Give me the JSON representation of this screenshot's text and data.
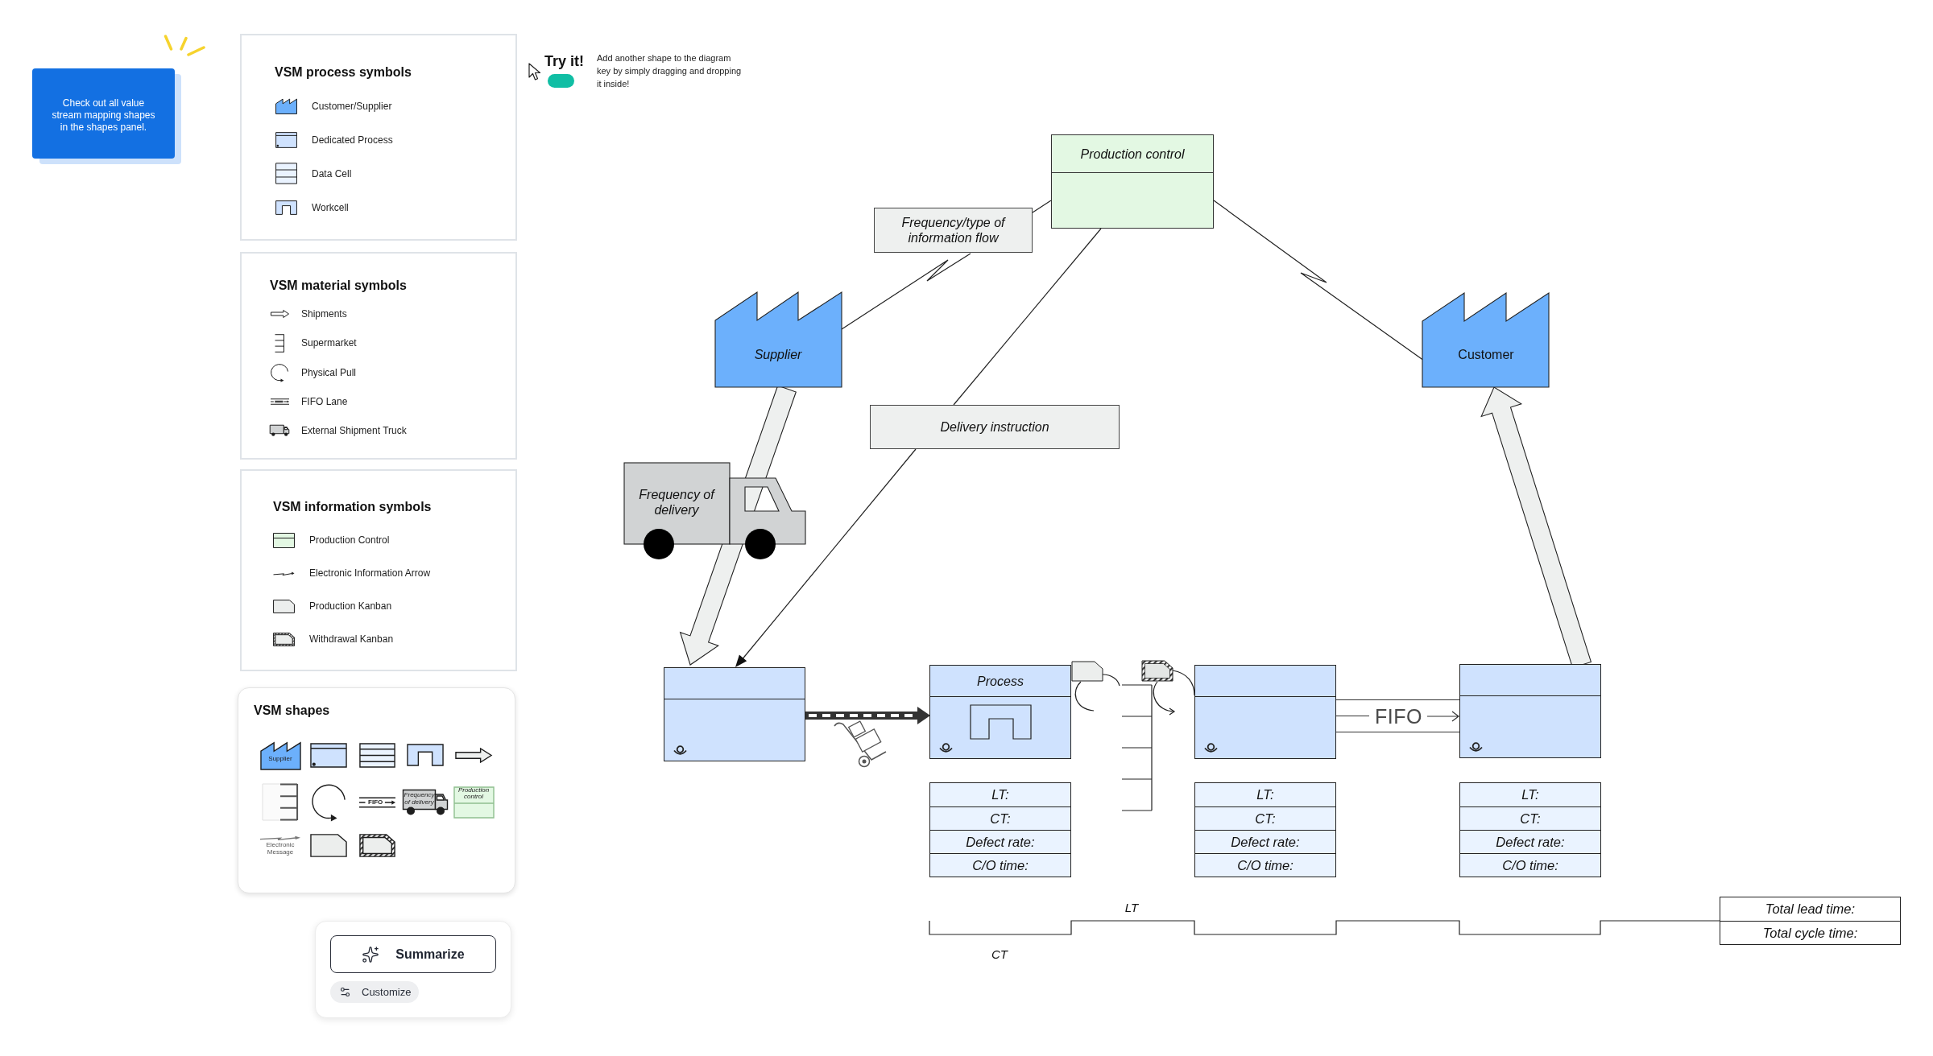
{
  "sticky_note": {
    "text": "Check out all value stream mapping shapes in the shapes panel."
  },
  "legend_panels": [
    {
      "title": "VSM process symbols",
      "items": [
        {
          "kind": "factory",
          "label": "Customer/Supplier"
        },
        {
          "kind": "dedicated_process",
          "label": "Dedicated Process"
        },
        {
          "kind": "data_cell",
          "label": "Data Cell"
        },
        {
          "kind": "workcell",
          "label": "Workcell"
        }
      ]
    },
    {
      "title": "VSM material symbols",
      "items": [
        {
          "kind": "shipment_arrow",
          "label": "Shipments"
        },
        {
          "kind": "supermarket",
          "label": "Supermarket"
        },
        {
          "kind": "physical_pull",
          "label": "Physical Pull"
        },
        {
          "kind": "fifo_lane",
          "label": "FIFO Lane"
        },
        {
          "kind": "truck",
          "label": "External Shipment Truck"
        }
      ]
    },
    {
      "title": "VSM information symbols",
      "items": [
        {
          "kind": "production_control",
          "label": "Production Control"
        },
        {
          "kind": "electronic_arrow",
          "label": "Electronic Information Arrow"
        },
        {
          "kind": "production_kanban",
          "label": "Production Kanban"
        },
        {
          "kind": "withdrawal_kanban",
          "label": "Withdrawal Kanban"
        }
      ]
    }
  ],
  "shapes_panel": {
    "title": "VSM shapes",
    "shapes": [
      {
        "kind": "factory",
        "label": "Supplier"
      },
      {
        "kind": "dedicated_process"
      },
      {
        "kind": "data_cell"
      },
      {
        "kind": "workcell"
      },
      {
        "kind": "shipment_arrow"
      },
      {
        "kind": "supermarket"
      },
      {
        "kind": "physical_pull"
      },
      {
        "kind": "fifo_lane",
        "label": "FIFO"
      },
      {
        "kind": "truck",
        "label": "Frequency of delivery"
      },
      {
        "kind": "production_control",
        "label": "Production control"
      },
      {
        "kind": "electronic_arrow",
        "label": "Electronic Message"
      },
      {
        "kind": "production_kanban"
      },
      {
        "kind": "withdrawal_kanban"
      }
    ]
  },
  "assistant": {
    "summarize_button": "Summarize",
    "customize_button": "Customize"
  },
  "try_it": {
    "title": "Try it!",
    "text": "Add another shape to the diagram key by simply dragging and dropping it inside!"
  },
  "diagram": {
    "production_control": {
      "title": "Production control"
    },
    "info_labels": [
      {
        "text": "Frequency/type of information flow"
      },
      {
        "text": "Delivery instruction"
      }
    ],
    "supplier": {
      "label": "Supplier"
    },
    "customer": {
      "label": "Customer"
    },
    "truck": {
      "label": "Frequency of delivery"
    },
    "processes": [
      {
        "workcell": false
      },
      {
        "title": "Process",
        "workcell": true
      },
      {
        "workcell": false
      },
      {
        "workcell": false
      }
    ],
    "data_tables": [
      {
        "rows": [
          "LT:",
          "CT:",
          "Defect rate:",
          "C/O time:"
        ]
      },
      {
        "rows": [
          "LT:",
          "CT:",
          "Defect rate:",
          "C/O time:"
        ]
      },
      {
        "rows": [
          "LT:",
          "CT:",
          "Defect rate:",
          "C/O time:"
        ]
      }
    ],
    "fifo": {
      "label": "FIFO"
    },
    "timeline": {
      "lead_time_label": "LT",
      "cycle_time_label": "CT"
    },
    "totals": [
      "Total lead time:",
      "Total cycle time:"
    ]
  }
}
